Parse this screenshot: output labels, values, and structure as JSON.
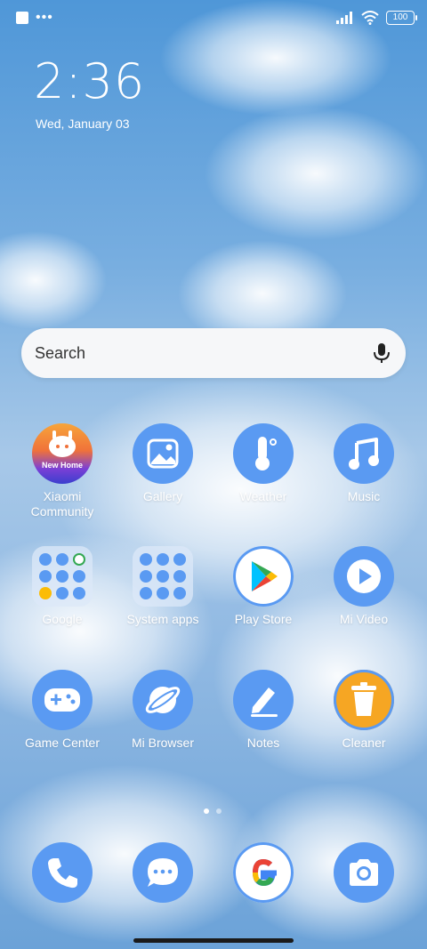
{
  "status_bar": {
    "battery": "100"
  },
  "lock": {
    "time": "2:36",
    "date": "Wed, January 03"
  },
  "search": {
    "placeholder": "Search"
  },
  "apps": [
    {
      "label": "Xiaomi Community",
      "badge": "New Home",
      "icon": "xiaomi-community-icon"
    },
    {
      "label": "Gallery",
      "icon": "gallery-icon"
    },
    {
      "label": "Weather",
      "icon": "thermometer-icon"
    },
    {
      "label": "Music",
      "icon": "music-note-icon"
    },
    {
      "label": "Google",
      "icon": "google-folder-icon"
    },
    {
      "label": "System apps",
      "icon": "system-apps-folder-icon"
    },
    {
      "label": "Play Store",
      "icon": "play-store-icon"
    },
    {
      "label": "Mi Video",
      "icon": "play-circle-icon"
    },
    {
      "label": "Game Center",
      "icon": "gamepad-icon"
    },
    {
      "label": "Mi Browser",
      "icon": "globe-icon"
    },
    {
      "label": "Notes",
      "icon": "pencil-icon"
    },
    {
      "label": "Cleaner",
      "icon": "trash-icon"
    }
  ],
  "dock": [
    {
      "icon": "phone-icon"
    },
    {
      "icon": "messages-icon"
    },
    {
      "icon": "google-icon"
    },
    {
      "icon": "camera-icon"
    }
  ],
  "colors": {
    "icon_blue": "#5a9af2",
    "accent_orange": "#f6a623"
  }
}
